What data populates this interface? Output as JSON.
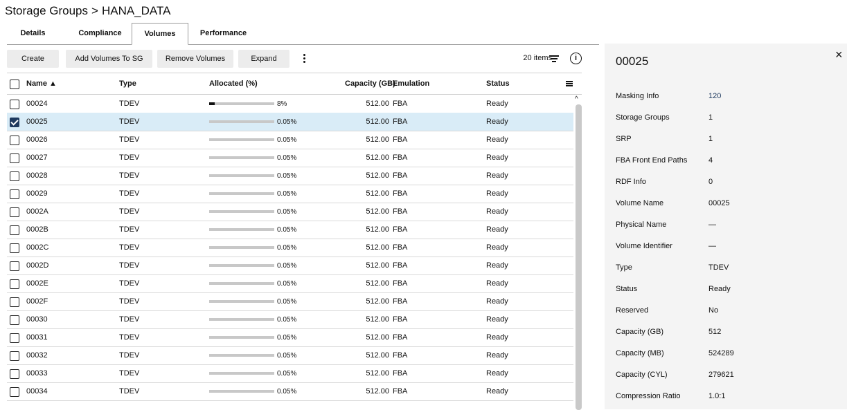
{
  "breadcrumb": {
    "parent": "Storage Groups",
    "separator": ">",
    "current": "HANA_DATA"
  },
  "tabs": [
    {
      "label": "Details",
      "active": false
    },
    {
      "label": "Compliance",
      "active": false
    },
    {
      "label": "Volumes",
      "active": true
    },
    {
      "label": "Performance",
      "active": false
    }
  ],
  "toolbar": {
    "create": "Create",
    "add_volumes": "Add Volumes To SG",
    "remove_volumes": "Remove Volumes",
    "expand": "Expand",
    "item_count": "20 items",
    "more_icon": "kebab-icon",
    "filter_icon": "filter-icon",
    "info_icon": "info-icon"
  },
  "table": {
    "columns": {
      "name": "Name ▲",
      "type": "Type",
      "allocated": "Allocated (%)",
      "capacity": "Capacity (GB)",
      "emulation": "Emulation",
      "status": "Status"
    },
    "rows": [
      {
        "name": "00024",
        "type": "TDEV",
        "allocated_label": "8%",
        "allocated_pct": 8,
        "capacity": "512.00",
        "emulation": "FBA",
        "status": "Ready",
        "selected": false
      },
      {
        "name": "00025",
        "type": "TDEV",
        "allocated_label": "0.05%",
        "allocated_pct": 0.05,
        "capacity": "512.00",
        "emulation": "FBA",
        "status": "Ready",
        "selected": true
      },
      {
        "name": "00026",
        "type": "TDEV",
        "allocated_label": "0.05%",
        "allocated_pct": 0.05,
        "capacity": "512.00",
        "emulation": "FBA",
        "status": "Ready",
        "selected": false
      },
      {
        "name": "00027",
        "type": "TDEV",
        "allocated_label": "0.05%",
        "allocated_pct": 0.05,
        "capacity": "512.00",
        "emulation": "FBA",
        "status": "Ready",
        "selected": false
      },
      {
        "name": "00028",
        "type": "TDEV",
        "allocated_label": "0.05%",
        "allocated_pct": 0.05,
        "capacity": "512.00",
        "emulation": "FBA",
        "status": "Ready",
        "selected": false
      },
      {
        "name": "00029",
        "type": "TDEV",
        "allocated_label": "0.05%",
        "allocated_pct": 0.05,
        "capacity": "512.00",
        "emulation": "FBA",
        "status": "Ready",
        "selected": false
      },
      {
        "name": "0002A",
        "type": "TDEV",
        "allocated_label": "0.05%",
        "allocated_pct": 0.05,
        "capacity": "512.00",
        "emulation": "FBA",
        "status": "Ready",
        "selected": false
      },
      {
        "name": "0002B",
        "type": "TDEV",
        "allocated_label": "0.05%",
        "allocated_pct": 0.05,
        "capacity": "512.00",
        "emulation": "FBA",
        "status": "Ready",
        "selected": false
      },
      {
        "name": "0002C",
        "type": "TDEV",
        "allocated_label": "0.05%",
        "allocated_pct": 0.05,
        "capacity": "512.00",
        "emulation": "FBA",
        "status": "Ready",
        "selected": false
      },
      {
        "name": "0002D",
        "type": "TDEV",
        "allocated_label": "0.05%",
        "allocated_pct": 0.05,
        "capacity": "512.00",
        "emulation": "FBA",
        "status": "Ready",
        "selected": false
      },
      {
        "name": "0002E",
        "type": "TDEV",
        "allocated_label": "0.05%",
        "allocated_pct": 0.05,
        "capacity": "512.00",
        "emulation": "FBA",
        "status": "Ready",
        "selected": false
      },
      {
        "name": "0002F",
        "type": "TDEV",
        "allocated_label": "0.05%",
        "allocated_pct": 0.05,
        "capacity": "512.00",
        "emulation": "FBA",
        "status": "Ready",
        "selected": false
      },
      {
        "name": "00030",
        "type": "TDEV",
        "allocated_label": "0.05%",
        "allocated_pct": 0.05,
        "capacity": "512.00",
        "emulation": "FBA",
        "status": "Ready",
        "selected": false
      },
      {
        "name": "00031",
        "type": "TDEV",
        "allocated_label": "0.05%",
        "allocated_pct": 0.05,
        "capacity": "512.00",
        "emulation": "FBA",
        "status": "Ready",
        "selected": false
      },
      {
        "name": "00032",
        "type": "TDEV",
        "allocated_label": "0.05%",
        "allocated_pct": 0.05,
        "capacity": "512.00",
        "emulation": "FBA",
        "status": "Ready",
        "selected": false
      },
      {
        "name": "00033",
        "type": "TDEV",
        "allocated_label": "0.05%",
        "allocated_pct": 0.05,
        "capacity": "512.00",
        "emulation": "FBA",
        "status": "Ready",
        "selected": false
      },
      {
        "name": "00034",
        "type": "TDEV",
        "allocated_label": "0.05%",
        "allocated_pct": 0.05,
        "capacity": "512.00",
        "emulation": "FBA",
        "status": "Ready",
        "selected": false
      }
    ]
  },
  "panel": {
    "title": "00025",
    "close_icon": "×",
    "fields": [
      {
        "label": "Masking Info",
        "value": "120",
        "link": true
      },
      {
        "label": "Storage Groups",
        "value": "1",
        "link": false
      },
      {
        "label": "SRP",
        "value": "1",
        "link": false
      },
      {
        "label": "FBA Front End Paths",
        "value": "4",
        "link": false
      },
      {
        "label": "RDF Info",
        "value": "0",
        "link": false
      },
      {
        "label": "Volume Name",
        "value": "00025",
        "link": false
      },
      {
        "label": "Physical Name",
        "value": "—",
        "link": false
      },
      {
        "label": "Volume Identifier",
        "value": "—",
        "link": false
      },
      {
        "label": "Type",
        "value": "TDEV",
        "link": false
      },
      {
        "label": "Status",
        "value": "Ready",
        "link": false
      },
      {
        "label": "Reserved",
        "value": "No",
        "link": false
      },
      {
        "label": "Capacity (GB)",
        "value": "512",
        "link": false
      },
      {
        "label": "Capacity (MB)",
        "value": "524289",
        "link": false
      },
      {
        "label": "Capacity (CYL)",
        "value": "279621",
        "link": false
      },
      {
        "label": "Compression Ratio",
        "value": "1.0:1",
        "link": false
      }
    ]
  },
  "colors": {
    "selected_row": "#d9ecf7",
    "link": "#1f3a5f",
    "panel_bg": "#f4f4f4"
  }
}
